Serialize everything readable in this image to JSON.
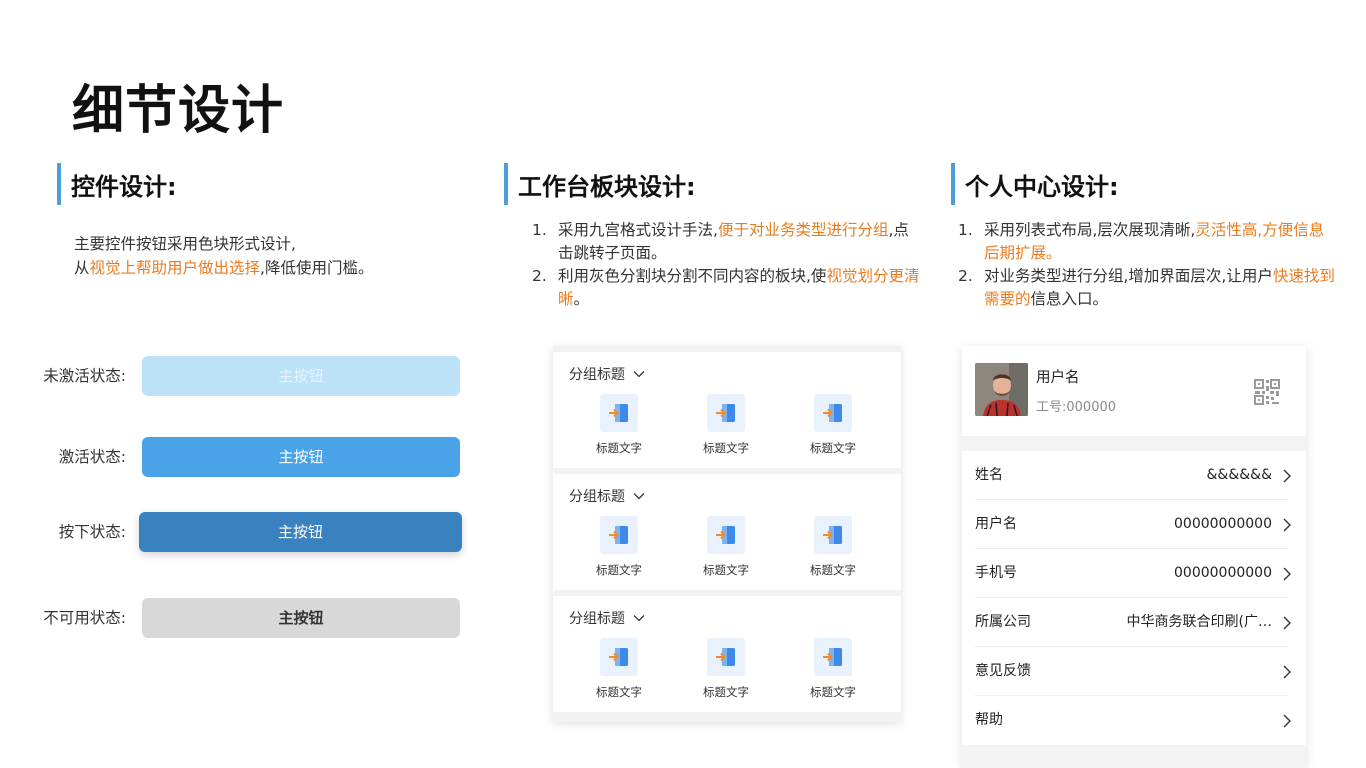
{
  "title": "细节设计",
  "sections": {
    "controls": {
      "heading": "控件设计:",
      "desc_line1": "主要控件按钮采用色块形式设计,",
      "desc_line2_pre": "从",
      "desc_line2_hl": "视觉上帮助用户做出选择",
      "desc_line2_post": ",降低使用门槛。",
      "states": [
        {
          "label": "未激活状态:",
          "button": "主按钮"
        },
        {
          "label": "激活状态:",
          "button": "主按钮"
        },
        {
          "label": "按下状态:",
          "button": "主按钮"
        },
        {
          "label": "不可用状态:",
          "button": "主按钮"
        }
      ]
    },
    "workspace": {
      "heading": "工作台板块设计:",
      "item1_num": "1.",
      "item1_pre": "采用九宫格式设计手法,",
      "item1_hl": "便于对业务类型进行分组",
      "item1_post": ",点击跳转子页面。",
      "item2_num": "2.",
      "item2_pre": "利用灰色分割块分割不同内容的板块,使",
      "item2_hl": "视觉划分更清晰",
      "item2_post": "。",
      "groups": [
        {
          "title": "分组标题",
          "items": [
            "标题文字",
            "标题文字",
            "标题文字"
          ]
        },
        {
          "title": "分组标题",
          "items": [
            "标题文字",
            "标题文字",
            "标题文字"
          ]
        },
        {
          "title": "分组标题",
          "items": [
            "标题文字",
            "标题文字",
            "标题文字"
          ]
        }
      ]
    },
    "profile": {
      "heading": "个人中心设计:",
      "item1_num": "1.",
      "item1_pre": "采用列表式布局,层次展现清晰,",
      "item1_hl": "灵活性高,方便信息后期扩展。",
      "item2_num": "2.",
      "item2_pre": "对业务类型进行分组,增加界面层次,让用户",
      "item2_hl": "快速找到需要的",
      "item2_post": "信息入口。",
      "user_name": "用户名",
      "user_job": "工号:000000",
      "rows": [
        {
          "key": "姓名",
          "value": "&&&&&&"
        },
        {
          "key": "用户名",
          "value": "00000000000"
        },
        {
          "key": "手机号",
          "value": "00000000000"
        },
        {
          "key": "所属公司",
          "value": "中华商务联合印刷(广…"
        },
        {
          "key": "意见反馈",
          "value": ""
        },
        {
          "key": "帮助",
          "value": ""
        }
      ]
    }
  },
  "colors": {
    "accent_blue": "#4aa3e6",
    "pressed_blue": "#3a82bf",
    "inactive_blue": "#bde2f8",
    "disabled_gray": "#d8d8d8",
    "highlight_orange": "#ec7b1e",
    "section_bar": "#4a9fdc"
  }
}
